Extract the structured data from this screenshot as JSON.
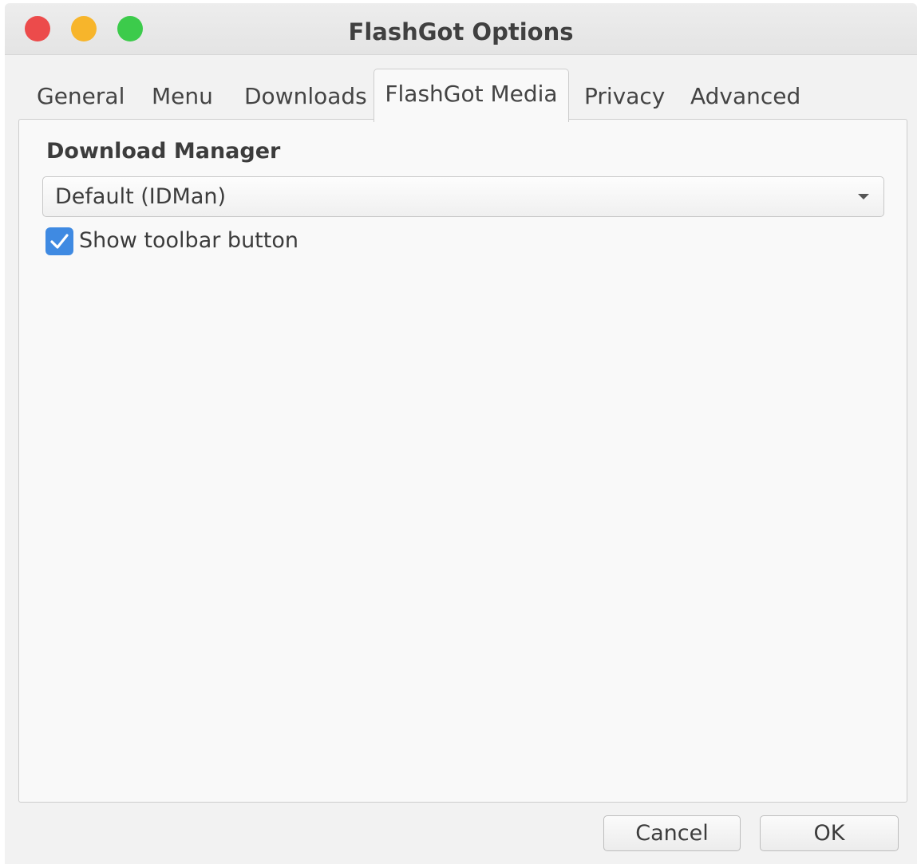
{
  "window": {
    "title": "FlashGot Options"
  },
  "tabs": [
    {
      "label": "General"
    },
    {
      "label": "Menu"
    },
    {
      "label": "Downloads"
    },
    {
      "label": "FlashGot Media"
    },
    {
      "label": "Privacy"
    },
    {
      "label": "Advanced"
    }
  ],
  "active_tab": "FlashGot Media",
  "panel": {
    "section_label": "Download Manager",
    "download_manager_select": {
      "value": "Default (IDMan)"
    },
    "show_toolbar_button": {
      "label": "Show toolbar button",
      "checked": true
    }
  },
  "buttons": {
    "cancel_label": "Cancel",
    "ok_label": "OK"
  },
  "colors": {
    "close": "#ec4b4b",
    "minimize": "#f7b52b",
    "maximize": "#3ccb4b",
    "checkbox_accent": "#3f8ae2"
  }
}
